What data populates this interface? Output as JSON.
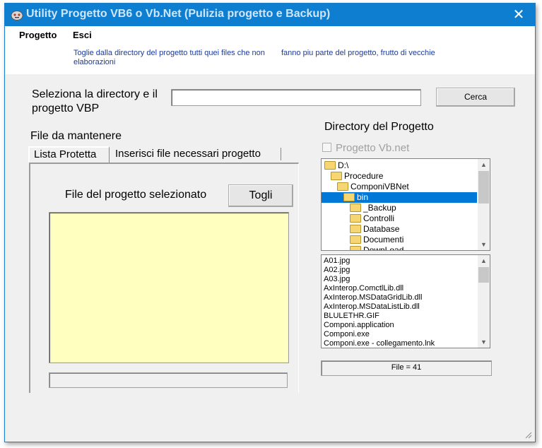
{
  "window": {
    "title": "Utility Progetto VB6 o Vb.Net (Pulizia progetto e Backup)",
    "close_glyph": "✕"
  },
  "menu": {
    "items": [
      "Progetto",
      "Esci"
    ]
  },
  "description": {
    "line1": "Toglie dalla directory del progetto tutti quei files che non",
    "line1b": "fanno piu parte del progetto, frutto di vecchie",
    "line2": "elaborazioni"
  },
  "selector": {
    "label": "Seleziona la directory e il progetto VBP",
    "path_value": "",
    "search_button": "Cerca"
  },
  "left": {
    "section_label": "File da mantenere",
    "tabs": [
      "Lista Protetta",
      "Inserisci file necessari progetto"
    ],
    "selected_label": "File del progetto selezionato",
    "remove_button": "Togli",
    "status_text": ""
  },
  "right": {
    "section_label": "Directory del Progetto",
    "vbnet_checkbox": "Progetto Vb.net",
    "vbnet_checked": false,
    "directories": [
      {
        "name": "D:\\",
        "level": 0,
        "open": true
      },
      {
        "name": "Procedure",
        "level": 1,
        "open": true
      },
      {
        "name": "ComponiVBNet",
        "level": 2,
        "open": true
      },
      {
        "name": "bin",
        "level": 3,
        "open": true,
        "selected": true
      },
      {
        "name": "_Backup",
        "level": 4
      },
      {
        "name": "Controlli",
        "level": 4
      },
      {
        "name": "Database",
        "level": 4
      },
      {
        "name": "Documenti",
        "level": 4
      },
      {
        "name": "DownLoad",
        "level": 4
      }
    ],
    "files": [
      "A01.jpg",
      "A02.jpg",
      "A03.jpg",
      "AxInterop.ComctlLib.dll",
      "AxInterop.MSDataGridLib.dll",
      "AxInterop.MSDataListLib.dll",
      "BLULETHR.GIF",
      "Componi.application",
      "Componi.exe",
      "Componi.exe - collegamento.lnk"
    ],
    "file_count": "File = 41"
  },
  "icons": [
    "app-icon",
    "close-icon",
    "folder-icon",
    "scroll-up-icon",
    "scroll-down-icon",
    "resize-grip-icon"
  ]
}
